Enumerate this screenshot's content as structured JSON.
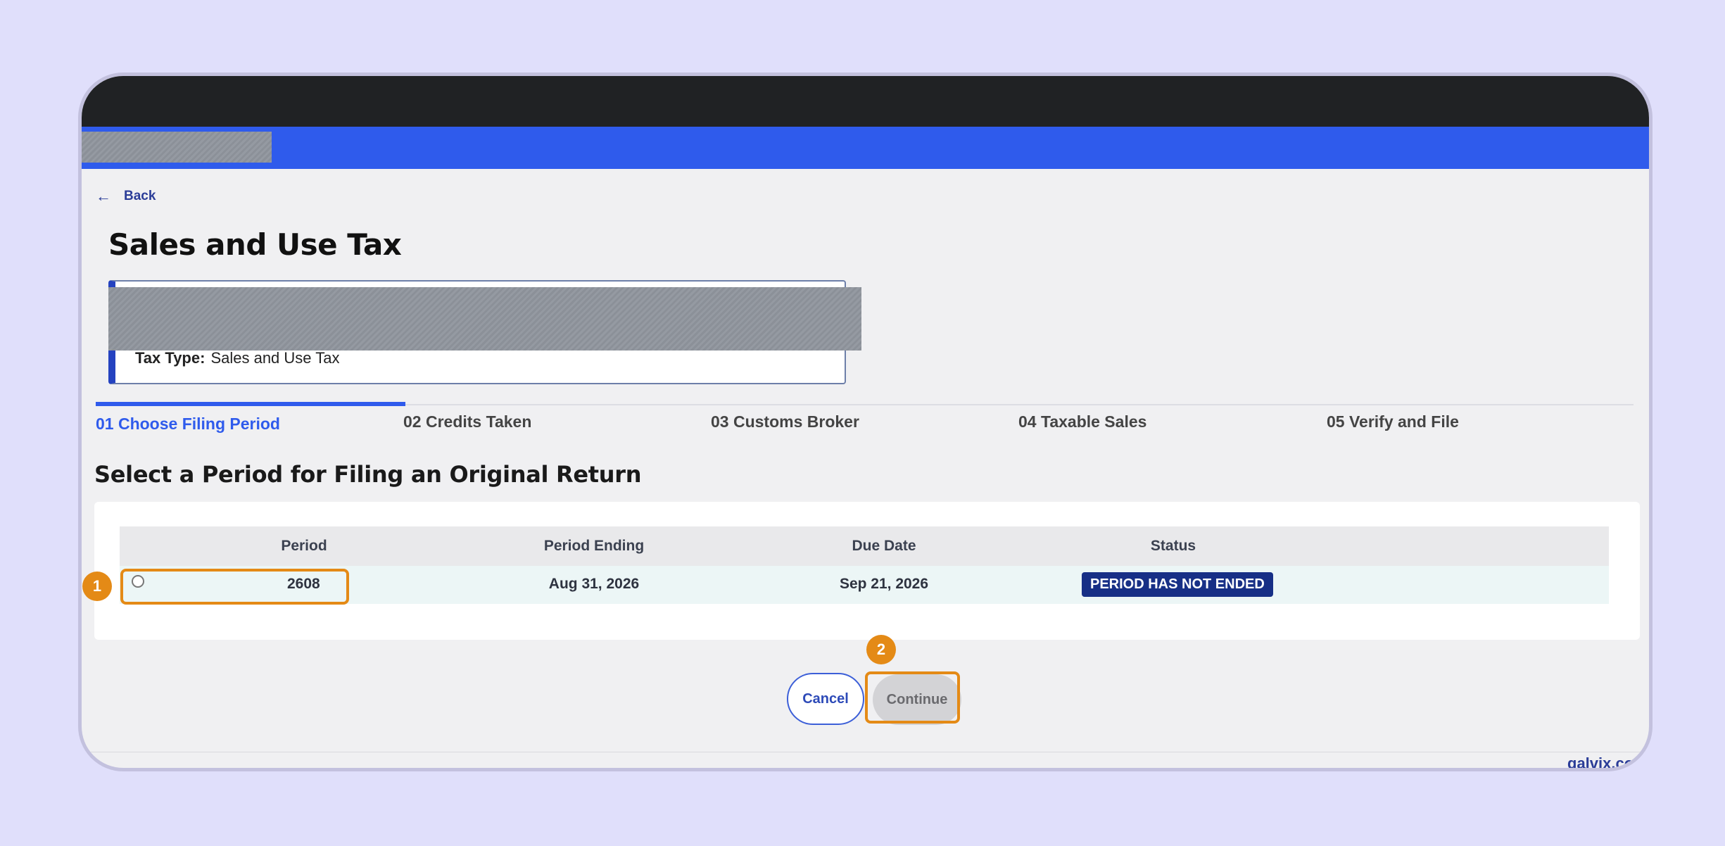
{
  "nav": {
    "back_label": "Back"
  },
  "page": {
    "title": "Sales and Use Tax",
    "tax_type_label": "Tax Type:",
    "tax_type_value": "Sales and Use Tax"
  },
  "steps": [
    {
      "label": "01 Choose Filing Period",
      "active": true
    },
    {
      "label": "02 Credits Taken",
      "active": false
    },
    {
      "label": "03 Customs Broker",
      "active": false
    },
    {
      "label": "04 Taxable Sales",
      "active": false
    },
    {
      "label": "05 Verify and File",
      "active": false
    }
  ],
  "section_title": "Select a Period for Filing an Original Return",
  "table": {
    "headers": [
      "Period",
      "Period Ending",
      "Due Date",
      "Status"
    ],
    "rows": [
      {
        "period": "2608",
        "period_ending": "Aug 31, 2026",
        "due_date": "Sep 21, 2026",
        "status": "PERIOD HAS NOT ENDED",
        "selected": false
      }
    ]
  },
  "buttons": {
    "cancel_label": "Cancel",
    "continue_label": "Continue"
  },
  "annotations": {
    "marker_1": "1",
    "marker_2": "2"
  },
  "footer": {
    "brand": "galvix.co"
  },
  "colors": {
    "accent": "#2f5bec",
    "badge": "#172f86",
    "highlight": "#e48a16",
    "background": "#e0dffb"
  }
}
